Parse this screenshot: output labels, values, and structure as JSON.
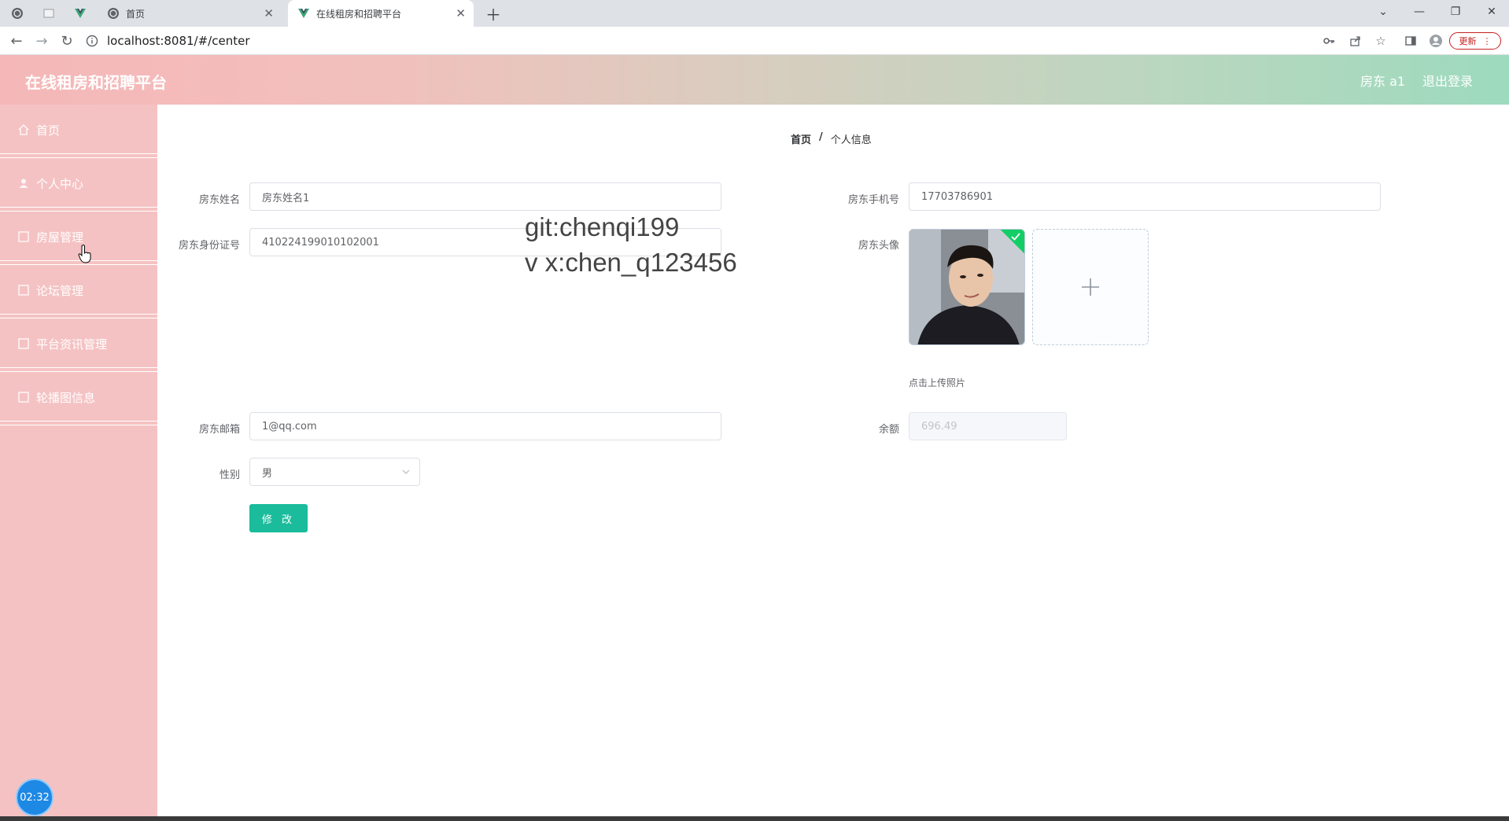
{
  "browser": {
    "tabs": [
      {
        "title": ""
      },
      {
        "title": ""
      },
      {
        "title": ""
      },
      {
        "title": "首页"
      },
      {
        "title": "在线租房和招聘平台"
      }
    ],
    "url": "localhost:8081/#/center",
    "update_label": "更新"
  },
  "header": {
    "title": "在线租房和招聘平台",
    "user": "房东 a1",
    "logout": "退出登录"
  },
  "sidebar": {
    "items": [
      {
        "label": "首页"
      },
      {
        "label": "个人中心"
      },
      {
        "label": "房屋管理"
      },
      {
        "label": "论坛管理"
      },
      {
        "label": "平台资讯管理"
      },
      {
        "label": "轮播图信息"
      }
    ],
    "timer": "02:32"
  },
  "breadcrumb": {
    "home": "首页",
    "sep": "/",
    "current": "个人信息"
  },
  "form": {
    "name_label": "房东姓名",
    "name_value": "房东姓名1",
    "id_label": "房东身份证号",
    "id_value": "410224199010102001",
    "email_label": "房东邮箱",
    "email_value": "1@qq.com",
    "gender_label": "性别",
    "gender_value": "男",
    "phone_label": "房东手机号",
    "phone_value": "17703786901",
    "avatar_label": "房东头像",
    "upload_tip": "点击上传照片",
    "balance_label": "余额",
    "balance_value": "696.49",
    "submit": "修 改"
  },
  "watermark": {
    "line1": "git:chenqi199",
    "line2": "v x:chen_q123456"
  },
  "colors": {
    "header_start": "#f5b7b8",
    "header_end": "#9ddabe",
    "sidebar_bg": "#f5c2c3",
    "submit_bg": "#1abc9c",
    "success_green": "#13ce66"
  }
}
